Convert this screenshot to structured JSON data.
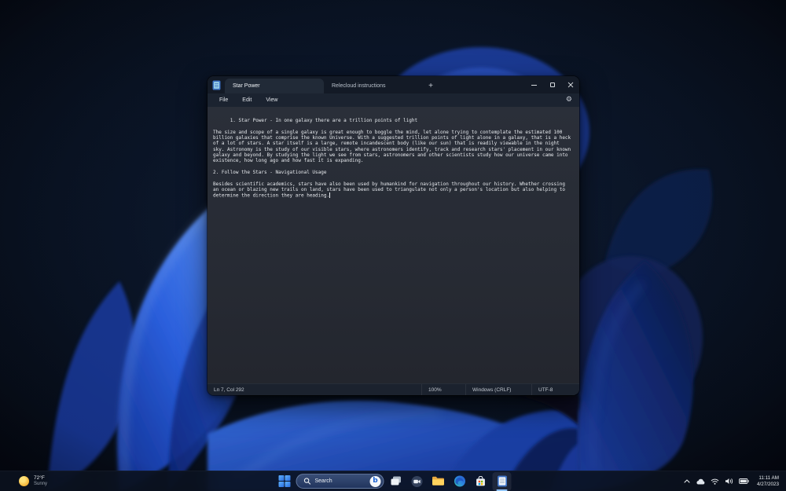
{
  "colors": {
    "accent_blue": "#4a9eee",
    "taskbar_active_underline": "#8fc3ff",
    "wallpaper_bright_blue": "#2f6bf0",
    "window_editor_bg": "#272b34",
    "window_titlebar_bg": "#131a26"
  },
  "icons": {
    "settings_gear": "⚙",
    "new_tab_plus": "+"
  },
  "window": {
    "tabs": [
      {
        "label": "Star Power",
        "active": true
      },
      {
        "label": "Relecloud instructions",
        "active": false
      }
    ],
    "menu": [
      "File",
      "Edit",
      "View"
    ],
    "document_text": "1. Star Power - In one galaxy there are a trillion points of light\n\nThe size and scope of a single galaxy is great enough to boggle the mind, let alone trying to contemplate the estimated 100 billion galaxies that comprise the known Universe. With a suggested trillion points of light alone in a galaxy, that is a heck of a lot of stars. A star itself is a large, remote incandescent body (like our sun) that is readily viewable in the night sky. Astronomy is the study of our visible stars, where astronomers identify, track and research stars' placement in our known galaxy and beyond. By studying the light we see from stars, astronomers and other scientists study how our universe came into existence, how long ago and how fast it is expanding.\n\n2. Follow the Stars - Navigational Usage\n\nBesides scientific academics, stars have also been used by humankind for navigation throughout our history. Whether crossing an ocean or blazing new trails on land, stars have been used to triangulate not only a person's location but also helping to determine the direction they are heading.",
    "status_bar": {
      "cursor_position": "Ln 7, Col 292",
      "zoom": "100%",
      "line_endings": "Windows (CRLF)",
      "encoding": "UTF-8"
    }
  },
  "taskbar": {
    "search": {
      "placeholder": "Search",
      "bing_letter": "b"
    },
    "buttons": [
      "start",
      "search",
      "task-view",
      "chat",
      "file-explorer",
      "edge",
      "microsoft-store",
      "notepad"
    ],
    "active_app": "notepad"
  },
  "widgets": {
    "weather": {
      "temperature": "72°F",
      "condition": "Sunny"
    }
  },
  "tray": {
    "icons": [
      "hidden-icons-chevron",
      "onedrive-cloud",
      "wifi",
      "volume",
      "battery"
    ],
    "clock": {
      "time": "11:11 AM",
      "date": "4/27/2023"
    }
  }
}
